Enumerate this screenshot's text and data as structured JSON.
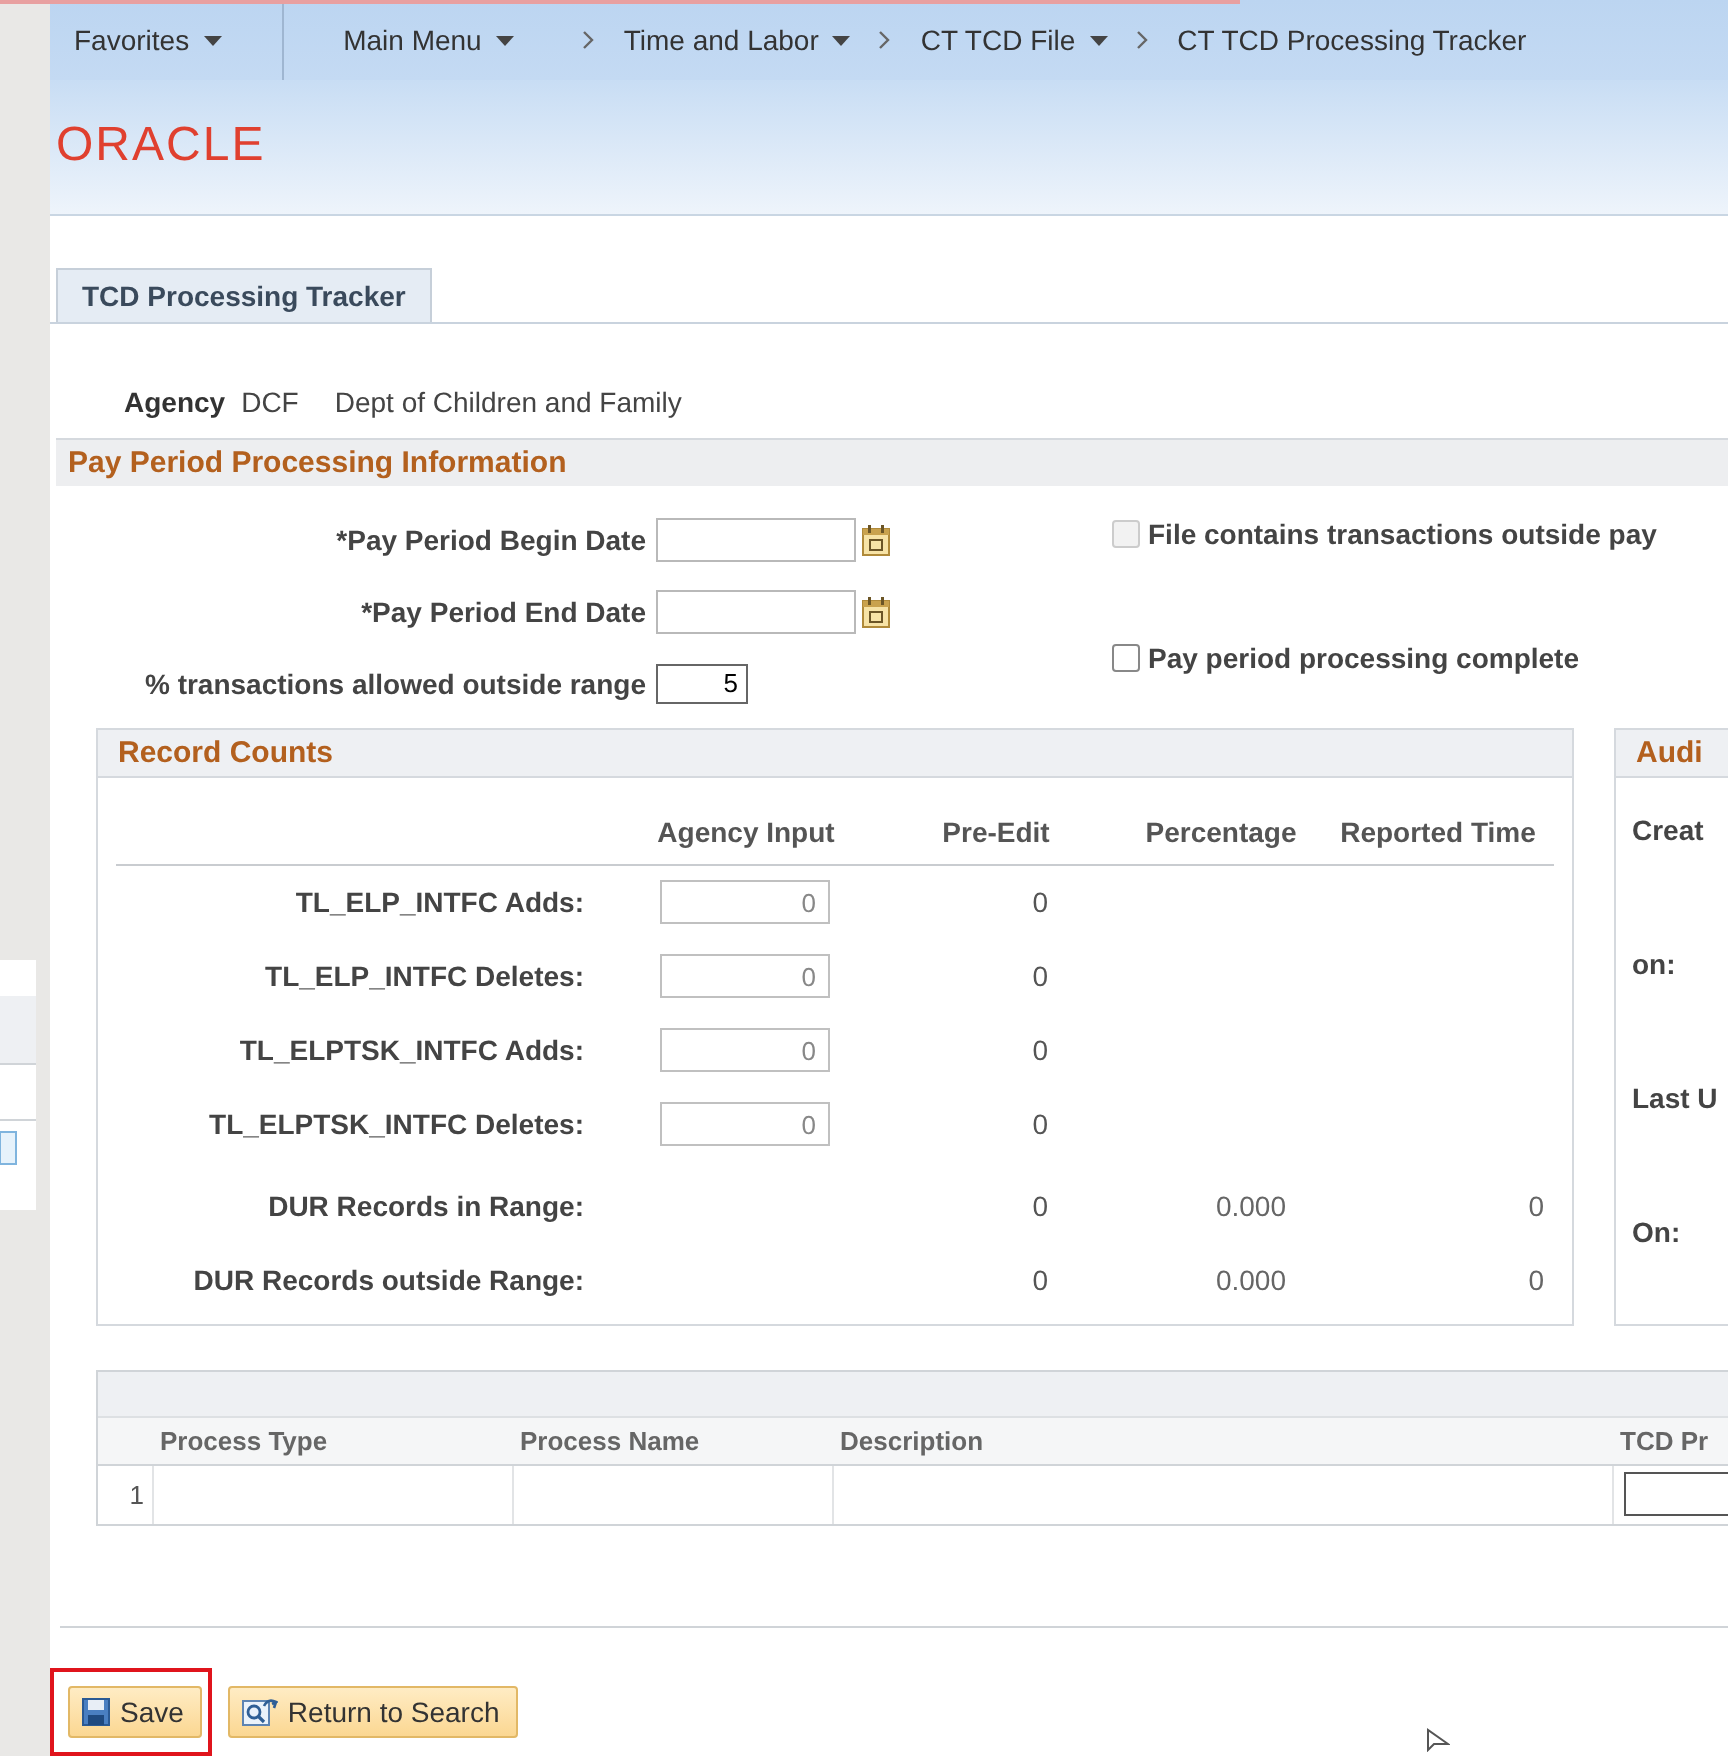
{
  "nav": {
    "items": [
      {
        "label": "Favorites",
        "kind": "menu",
        "dropdown": true
      },
      {
        "label": "Main Menu",
        "kind": "menu",
        "dropdown": true
      },
      {
        "label": "Time and Labor",
        "kind": "crumb",
        "dropdown": true
      },
      {
        "label": "CT TCD File",
        "kind": "crumb",
        "dropdown": true
      },
      {
        "label": "CT TCD Processing Tracker",
        "kind": "crumb",
        "dropdown": false
      }
    ]
  },
  "logo": "ORACLE",
  "tabs": [
    {
      "label": "TCD Processing Tracker",
      "selected": true
    }
  ],
  "agency": {
    "label": "Agency",
    "code": "DCF",
    "name": "Dept of Children and Family"
  },
  "section": {
    "title": "Pay Period Processing Information"
  },
  "fields": [
    {
      "label": "*Pay Period Begin Date",
      "kind": "date"
    },
    {
      "label": "*Pay Period End Date",
      "kind": "date"
    },
    {
      "label": "% transactions allowed outside range",
      "kind": "number",
      "value": "5"
    }
  ],
  "checkboxes": [
    {
      "label": "File contains transactions outside pay",
      "checked": false,
      "disabled": true
    },
    {
      "label": "Pay period processing complete",
      "checked": false,
      "disabled": false
    }
  ],
  "record_counts": {
    "title": "Record Counts",
    "columns": [
      "Agency Input",
      "Pre-Edit",
      "Percentage",
      "Reported Time"
    ],
    "rows": [
      {
        "label": "TL_ELP_INTFC Adds:",
        "kind": "input",
        "input": "0",
        "pre_edit": "0"
      },
      {
        "label": "TL_ELP_INTFC Deletes:",
        "kind": "input",
        "input": "0",
        "pre_edit": "0"
      },
      {
        "label": "TL_ELPTSK_INTFC Adds:",
        "kind": "input",
        "input": "0",
        "pre_edit": "0"
      },
      {
        "label": "TL_ELPTSK_INTFC Deletes:",
        "kind": "input",
        "input": "0",
        "pre_edit": "0"
      },
      {
        "label": "DUR Records in Range:",
        "kind": "display",
        "pre_edit": "0",
        "percentage": "0.000",
        "reported_time": "0"
      },
      {
        "label": "DUR Records outside Range:",
        "kind": "display",
        "pre_edit": "0",
        "percentage": "0.000",
        "reported_time": "0"
      }
    ]
  },
  "audit": {
    "title": "Audi",
    "labels": [
      "Creat",
      "on:",
      "Last U",
      "On:"
    ]
  },
  "grid": {
    "columns": [
      "Process Type",
      "Process Name",
      "Description",
      "TCD Pr"
    ],
    "rows": [
      {
        "number": "1"
      }
    ]
  },
  "buttons": [
    {
      "label": "Save",
      "kind": "save",
      "highlighted": true
    },
    {
      "label": "Return to Search",
      "kind": "search",
      "highlighted": false
    }
  ]
}
